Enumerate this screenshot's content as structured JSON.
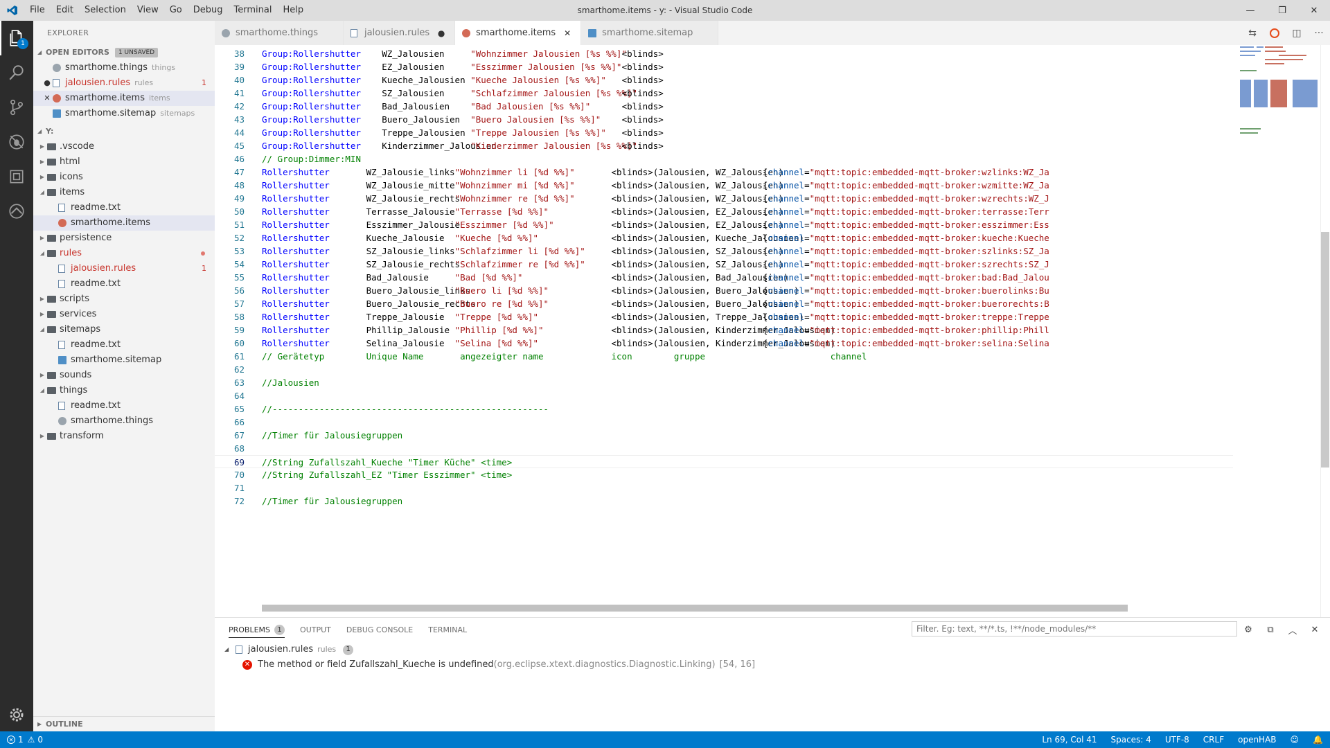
{
  "window": {
    "title": "smarthome.items - y: - Visual Studio Code",
    "menu": [
      "File",
      "Edit",
      "Selection",
      "View",
      "Go",
      "Debug",
      "Terminal",
      "Help"
    ],
    "controls": [
      "—",
      "❐",
      "✕"
    ]
  },
  "activity_bar": {
    "items": [
      "explorer-icon",
      "search-icon",
      "source-control-icon",
      "debug-icon",
      "extensions-icon",
      "openhab-icon"
    ],
    "explorer_badge": "1",
    "bottom": "settings-gear-icon"
  },
  "sidebar": {
    "title": "EXPLORER",
    "open_editors": {
      "header": "OPEN EDITORS",
      "badge": "1 UNSAVED",
      "items": [
        {
          "name": "smarthome.things",
          "desc": "things",
          "mark": "",
          "icon": "gear",
          "error": false,
          "count": ""
        },
        {
          "name": "jalousien.rules",
          "desc": "rules",
          "mark": "●",
          "icon": "file",
          "error": true,
          "count": "1"
        },
        {
          "name": "smarthome.items",
          "desc": "items",
          "mark": "✕",
          "icon": "red",
          "error": false,
          "count": "",
          "selected": true
        },
        {
          "name": "smarthome.sitemap",
          "desc": "sitemaps",
          "mark": "",
          "icon": "sitemap",
          "error": false,
          "count": ""
        }
      ]
    },
    "folder": {
      "header": "Y:",
      "tree": [
        {
          "name": ".vscode",
          "type": "folder",
          "depth": 0,
          "expanded": false
        },
        {
          "name": "html",
          "type": "folder",
          "depth": 0,
          "expanded": false
        },
        {
          "name": "icons",
          "type": "folder",
          "depth": 0,
          "expanded": false
        },
        {
          "name": "items",
          "type": "folder",
          "depth": 0,
          "expanded": true
        },
        {
          "name": "readme.txt",
          "type": "file",
          "depth": 1
        },
        {
          "name": "smarthome.items",
          "type": "red",
          "depth": 1,
          "selected": true
        },
        {
          "name": "persistence",
          "type": "folder",
          "depth": 0,
          "expanded": false
        },
        {
          "name": "rules",
          "type": "folder",
          "depth": 0,
          "expanded": true,
          "error": true,
          "dot": true
        },
        {
          "name": "jalousien.rules",
          "type": "file",
          "depth": 1,
          "error": true,
          "count": "1"
        },
        {
          "name": "readme.txt",
          "type": "file",
          "depth": 1
        },
        {
          "name": "scripts",
          "type": "folder",
          "depth": 0,
          "expanded": false
        },
        {
          "name": "services",
          "type": "folder",
          "depth": 0,
          "expanded": false
        },
        {
          "name": "sitemaps",
          "type": "folder",
          "depth": 0,
          "expanded": true
        },
        {
          "name": "readme.txt",
          "type": "file",
          "depth": 1
        },
        {
          "name": "smarthome.sitemap",
          "type": "sitemap",
          "depth": 1
        },
        {
          "name": "sounds",
          "type": "folder",
          "depth": 0,
          "expanded": false
        },
        {
          "name": "things",
          "type": "folder",
          "depth": 0,
          "expanded": true
        },
        {
          "name": "readme.txt",
          "type": "file",
          "depth": 1
        },
        {
          "name": "smarthome.things",
          "type": "gear",
          "depth": 1
        },
        {
          "name": "transform",
          "type": "folder",
          "depth": 0,
          "expanded": false
        }
      ]
    },
    "outline": "OUTLINE"
  },
  "tabs": [
    {
      "name": "smarthome.things",
      "icon": "gear",
      "active": false,
      "close": ""
    },
    {
      "name": "jalousien.rules",
      "icon": "file",
      "active": false,
      "close": "●"
    },
    {
      "name": "smarthome.items",
      "icon": "red",
      "active": true,
      "close": "✕"
    },
    {
      "name": "smarthome.sitemap",
      "icon": "sitemap",
      "active": false,
      "close": ""
    }
  ],
  "editor_actions": [
    "open-changes-icon",
    "openhab-preview-icon",
    "split-editor-icon",
    "more-icon"
  ],
  "code": {
    "current_line": 69,
    "lines": [
      {
        "n": 38,
        "t": "group",
        "a": "Group:Rollershutter",
        "b": "WZ_Jalousien",
        "c": "\"Wohnzimmer Jalousien [%s %%]\"",
        "d": "<blinds>"
      },
      {
        "n": 39,
        "t": "group",
        "a": "Group:Rollershutter",
        "b": "EZ_Jalousien",
        "c": "\"Esszimmer Jalousien [%s %%]\"",
        "d": "<blinds>"
      },
      {
        "n": 40,
        "t": "group",
        "a": "Group:Rollershutter",
        "b": "Kueche_Jalousien",
        "c": "\"Kueche Jalousien [%s %%]\"",
        "d": "<blinds>"
      },
      {
        "n": 41,
        "t": "group",
        "a": "Group:Rollershutter",
        "b": "SZ_Jalousien",
        "c": "\"Schlafzimmer Jalousien [%s %%]\"",
        "d": "<blinds>"
      },
      {
        "n": 42,
        "t": "group",
        "a": "Group:Rollershutter",
        "b": "Bad_Jalousien",
        "c": "\"Bad Jalousien [%s %%]\"",
        "d": "<blinds>"
      },
      {
        "n": 43,
        "t": "group",
        "a": "Group:Rollershutter",
        "b": "Buero_Jalousien",
        "c": "\"Buero Jalousien [%s %%]\"",
        "d": "<blinds>"
      },
      {
        "n": 44,
        "t": "group",
        "a": "Group:Rollershutter",
        "b": "Treppe_Jalousien",
        "c": "\"Treppe Jalousien [%s %%]\"",
        "d": "<blinds>"
      },
      {
        "n": 45,
        "t": "group",
        "a": "Group:Rollershutter",
        "b": "Kinderzimmer_Jalousien",
        "c": "\"Kinderzimmer Jalousien [%s %%]\"",
        "d": "<blinds>"
      },
      {
        "n": 46,
        "t": "comment",
        "text": "// Group:Dimmer:MIN"
      },
      {
        "n": 47,
        "t": "item",
        "a": "Rollershutter",
        "b": "WZ_Jalousie_links",
        "c": "\"Wohnzimmer li [%d %%]\"",
        "d": "<blinds>",
        "e": "(Jalousien, WZ_Jalousien)",
        "k": "channel",
        "v": "\"mqtt:topic:embedded-mqtt-broker:wzlinks:WZ_Ja"
      },
      {
        "n": 48,
        "t": "item",
        "a": "Rollershutter",
        "b": "WZ_Jalousie_mitte",
        "c": "\"Wohnzimmer mi [%d %%]\"",
        "d": "<blinds>",
        "e": "(Jalousien, WZ_Jalousien)",
        "k": "channel",
        "v": "\"mqtt:topic:embedded-mqtt-broker:wzmitte:WZ_Ja"
      },
      {
        "n": 49,
        "t": "item",
        "a": "Rollershutter",
        "b": "WZ_Jalousie_rechts",
        "c": "\"Wohnzimmer re [%d %%]\"",
        "d": "<blinds>",
        "e": "(Jalousien, WZ_Jalousien)",
        "k": "channel",
        "v": "\"mqtt:topic:embedded-mqtt-broker:wzrechts:WZ_J"
      },
      {
        "n": 50,
        "t": "item",
        "a": "Rollershutter",
        "b": "Terrasse_Jalousie",
        "c": "\"Terrasse [%d %%]\"",
        "d": "<blinds>",
        "e": "(Jalousien, EZ_Jalousien)",
        "k": "channel",
        "v": "\"mqtt:topic:embedded-mqtt-broker:terrasse:Terr"
      },
      {
        "n": 51,
        "t": "item",
        "a": "Rollershutter",
        "b": "Esszimmer_Jalousie",
        "c": "\"Esszimmer [%d %%]\"",
        "d": "<blinds>",
        "e": "(Jalousien, EZ_Jalousien)",
        "k": "channel",
        "v": "\"mqtt:topic:embedded-mqtt-broker:esszimmer:Ess"
      },
      {
        "n": 52,
        "t": "item",
        "a": "Rollershutter",
        "b": "Kueche_Jalousie",
        "c": "\"Kueche [%d %%]\"",
        "d": "<blinds>",
        "e": "(Jalousien, Kueche_Jalousien)",
        "k": "channel",
        "v": "\"mqtt:topic:embedded-mqtt-broker:kueche:Kueche"
      },
      {
        "n": 53,
        "t": "item",
        "a": "Rollershutter",
        "b": "SZ_Jalousie_links",
        "c": "\"Schlafzimmer li [%d %%]\"",
        "d": "<blinds>",
        "e": "(Jalousien, SZ_Jalousien)",
        "k": "channel",
        "v": "\"mqtt:topic:embedded-mqtt-broker:szlinks:SZ_Ja"
      },
      {
        "n": 54,
        "t": "item",
        "a": "Rollershutter",
        "b": "SZ_Jalousie_rechts",
        "c": "\"Schlafzimmer re [%d %%]\"",
        "d": "<blinds>",
        "e": "(Jalousien, SZ_Jalousien)",
        "k": "channel",
        "v": "\"mqtt:topic:embedded-mqtt-broker:szrechts:SZ_J"
      },
      {
        "n": 55,
        "t": "item",
        "a": "Rollershutter",
        "b": "Bad_Jalousie",
        "c": "\"Bad [%d %%]\"",
        "d": "<blinds>",
        "e": "(Jalousien, Bad_Jalousien)",
        "k": "channel",
        "v": "\"mqtt:topic:embedded-mqtt-broker:bad:Bad_Jalou"
      },
      {
        "n": 56,
        "t": "item",
        "a": "Rollershutter",
        "b": "Buero_Jalousie_links",
        "c": "\"Buero li [%d %%]\"",
        "d": "<blinds>",
        "e": "(Jalousien, Buero_Jalousien)",
        "k": "channel",
        "v": "\"mqtt:topic:embedded-mqtt-broker:buerolinks:Bu"
      },
      {
        "n": 57,
        "t": "item",
        "a": "Rollershutter",
        "b": "Buero_Jalousie_rechts",
        "c": "\"Buero re [%d %%]\"",
        "d": "<blinds>",
        "e": "(Jalousien, Buero_Jalousien)",
        "k": "channel",
        "v": "\"mqtt:topic:embedded-mqtt-broker:buerorechts:B"
      },
      {
        "n": 58,
        "t": "item",
        "a": "Rollershutter",
        "b": "Treppe_Jalousie",
        "c": "\"Treppe [%d %%]\"",
        "d": "<blinds>",
        "e": "(Jalousien, Treppe_Jalousien)",
        "k": "channel",
        "v": "\"mqtt:topic:embedded-mqtt-broker:treppe:Treppe"
      },
      {
        "n": 59,
        "t": "item",
        "a": "Rollershutter",
        "b": "Phillip_Jalousie",
        "c": "\"Phillip [%d %%]\"",
        "d": "<blinds>",
        "e": "(Jalousien, Kinderzimmer_Jalousien)",
        "k": "channel",
        "v": "\"mqtt:topic:embedded-mqtt-broker:phillip:Phill"
      },
      {
        "n": 60,
        "t": "item",
        "a": "Rollershutter",
        "b": "Selina_Jalousie",
        "c": "\"Selina [%d %%]\"",
        "d": "<blinds>",
        "e": "(Jalousien, Kinderzimmer_Jalousien)",
        "k": "channel",
        "v": "\"mqtt:topic:embedded-mqtt-broker:selina:Selina"
      },
      {
        "n": 61,
        "t": "header",
        "a": "// Gerätetyp",
        "b": "Unique Name",
        "c": "angezeigter name",
        "d": "icon",
        "e": "gruppe",
        "f": "channel"
      },
      {
        "n": 62,
        "t": "blank"
      },
      {
        "n": 63,
        "t": "comment",
        "text": "//Jalousien"
      },
      {
        "n": 64,
        "t": "blank"
      },
      {
        "n": 65,
        "t": "comment",
        "text": "//-----------------------------------------------------"
      },
      {
        "n": 66,
        "t": "blank"
      },
      {
        "n": 67,
        "t": "comment",
        "text": "//Timer für Jalousiegruppen"
      },
      {
        "n": 68,
        "t": "blank"
      },
      {
        "n": 69,
        "t": "comment",
        "text": "//String Zufallszahl_Kueche \"Timer Küche\" <time>"
      },
      {
        "n": 70,
        "t": "comment",
        "text": "//String Zufallszahl_EZ \"Timer Esszimmer\" <time>"
      },
      {
        "n": 71,
        "t": "blank"
      },
      {
        "n": 72,
        "t": "comment",
        "text": "//Timer für Jalousiegruppen"
      }
    ]
  },
  "panel": {
    "tabs": [
      {
        "label": "PROBLEMS",
        "badge": "1",
        "active": true
      },
      {
        "label": "OUTPUT",
        "badge": "",
        "active": false
      },
      {
        "label": "DEBUG CONSOLE",
        "badge": "",
        "active": false
      },
      {
        "label": "TERMINAL",
        "badge": "",
        "active": false
      }
    ],
    "filter_placeholder": "Filter. Eg: text, **/*.ts, !**/node_modules/**",
    "actions": [
      "filter-settings-icon",
      "collapse-all-icon",
      "maximize-panel-icon",
      "close-panel-icon"
    ],
    "problem_file": {
      "name": "jalousien.rules",
      "folder": "rules",
      "count": "1"
    },
    "problem": {
      "message": "The method or field Zufallszahl_Kueche is undefined",
      "source": "(org.eclipse.xtext.diagnostics.Diagnostic.Linking)",
      "position": "[54, 16]"
    }
  },
  "statusbar": {
    "errors": "1",
    "warnings": "0",
    "position": "Ln 69, Col 41",
    "spaces": "Spaces: 4",
    "encoding": "UTF-8",
    "eol": "CRLF",
    "language": "openHAB",
    "colors": {
      "background": "#007acc"
    }
  }
}
